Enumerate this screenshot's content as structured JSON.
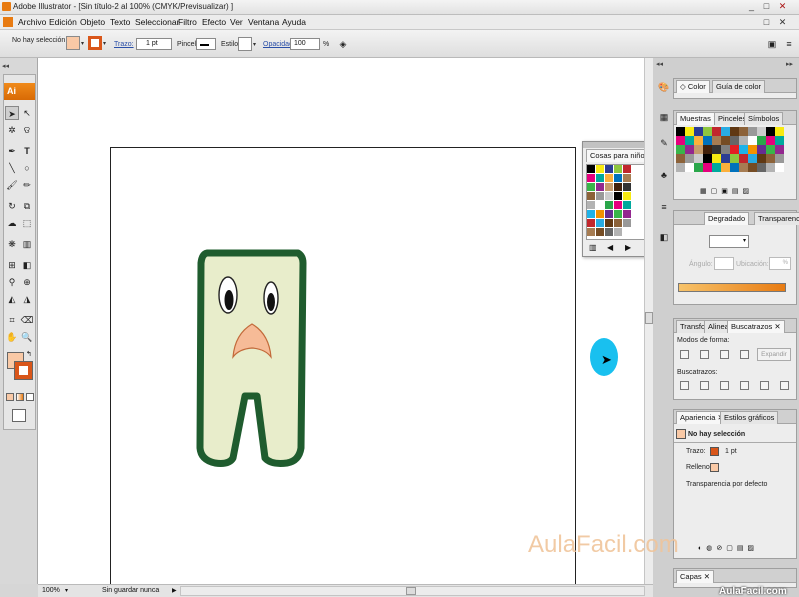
{
  "window": {
    "title": "Adobe Illustrator - [Sin título-2 al 100% (CMYK/Previsualizar) ]",
    "min": "_",
    "max": "□",
    "close": "✕"
  },
  "menu": [
    "Archivo",
    "Edición",
    "Objeto",
    "Texto",
    "Seleccionar",
    "Filtro",
    "Efecto",
    "Ver",
    "Ventana",
    "Ayuda"
  ],
  "control": {
    "selection": "No hay selección",
    "stroke_label": "Trazo:",
    "stroke_value": "1 pt",
    "brush_label": "Pincel:",
    "style_label": "Estilo:",
    "opacity_label": "Opacidad:",
    "opacity_value": "100",
    "percent": "%"
  },
  "tools": {
    "logo": "Ai"
  },
  "status": {
    "zoom": "100%",
    "info": "Sin guardar nunca"
  },
  "panels": {
    "color": {
      "tabs": [
        "Color",
        "Guía de color"
      ]
    },
    "swatches": {
      "tabs": [
        "Muestras",
        "Pinceles",
        "Símbolos"
      ]
    },
    "gradient": {
      "tabs": [
        "Degradado",
        "Transparencia"
      ],
      "angle_label": "Ángulo:",
      "position_label": "Ubicación:",
      "percent": "%"
    },
    "pathfinder": {
      "tabs": [
        "Transfo",
        "Alinear",
        "Buscatrazos"
      ],
      "shape_modes": "Modos de forma:",
      "expand": "Expandir",
      "pathfinders": "Buscatrazos:"
    },
    "appearance": {
      "tabs": [
        "Apariencia",
        "Estilos gráficos"
      ],
      "header": "No hay selección",
      "stroke_label": "Trazo:",
      "stroke_value": "1 pt",
      "fill_label": "Relleno:",
      "opacity": "Transparencia por defecto"
    },
    "layers": {
      "tabs": [
        "Capas"
      ]
    },
    "cosas": {
      "title": "Cosas para niños"
    }
  },
  "watermark": {
    "main": "AulaFacil.com",
    "corner": "AulaFacil.com"
  },
  "colors": {
    "accent": "#e87b12",
    "fill_swatch": "#f9c9a6",
    "stroke_swatch": "#d9561a",
    "character_outline": "#1f5c2e",
    "character_fill": "#e8edcb",
    "cursor_highlight": "#19c0ef"
  }
}
